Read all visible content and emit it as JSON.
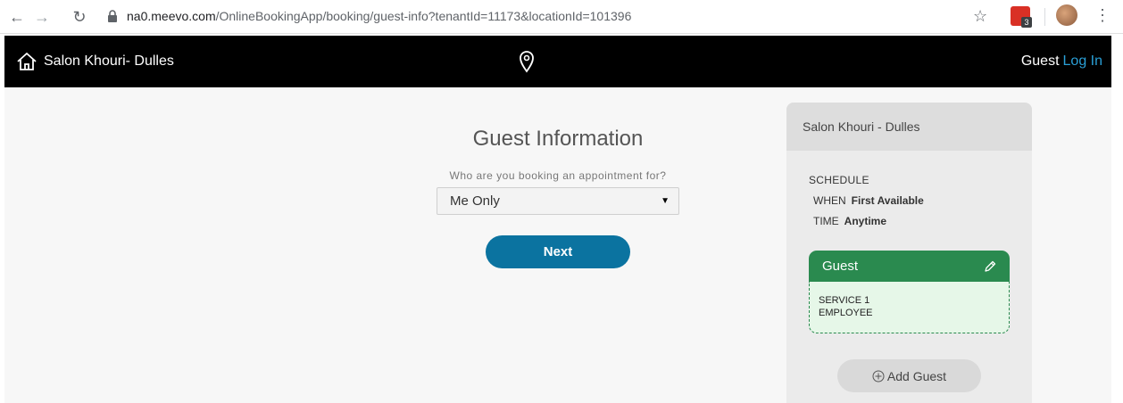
{
  "browser": {
    "url_host": "na0.meevo.com",
    "url_path": "/OnlineBookingApp/booking/guest-info?tenantId=11173&locationId=101396",
    "extension_badge": "3"
  },
  "header": {
    "salon_name": "Salon Khouri- Dulles",
    "guest_label": "Guest",
    "login_label": "Log In"
  },
  "main": {
    "title": "Guest Information",
    "question": "Who are you booking an appointment for?",
    "selected_option": "Me Only",
    "next_label": "Next"
  },
  "summary": {
    "salon_name": "Salon Khouri - Dulles",
    "schedule_title": "SCHEDULE",
    "when_label": "WHEN",
    "when_value": "First Available",
    "time_label": "TIME",
    "time_value": "Anytime",
    "guest_card": {
      "title": "Guest",
      "service": "SERVICE 1",
      "employee": "EMPLOYEE"
    },
    "add_guest_label": "Add Guest"
  },
  "colors": {
    "header_bg": "#000000",
    "login_link": "#2a9fd6",
    "next_button": "#0b73a0",
    "guest_card_head": "#2a8a4f",
    "guest_card_body": "#e6f7e8"
  }
}
